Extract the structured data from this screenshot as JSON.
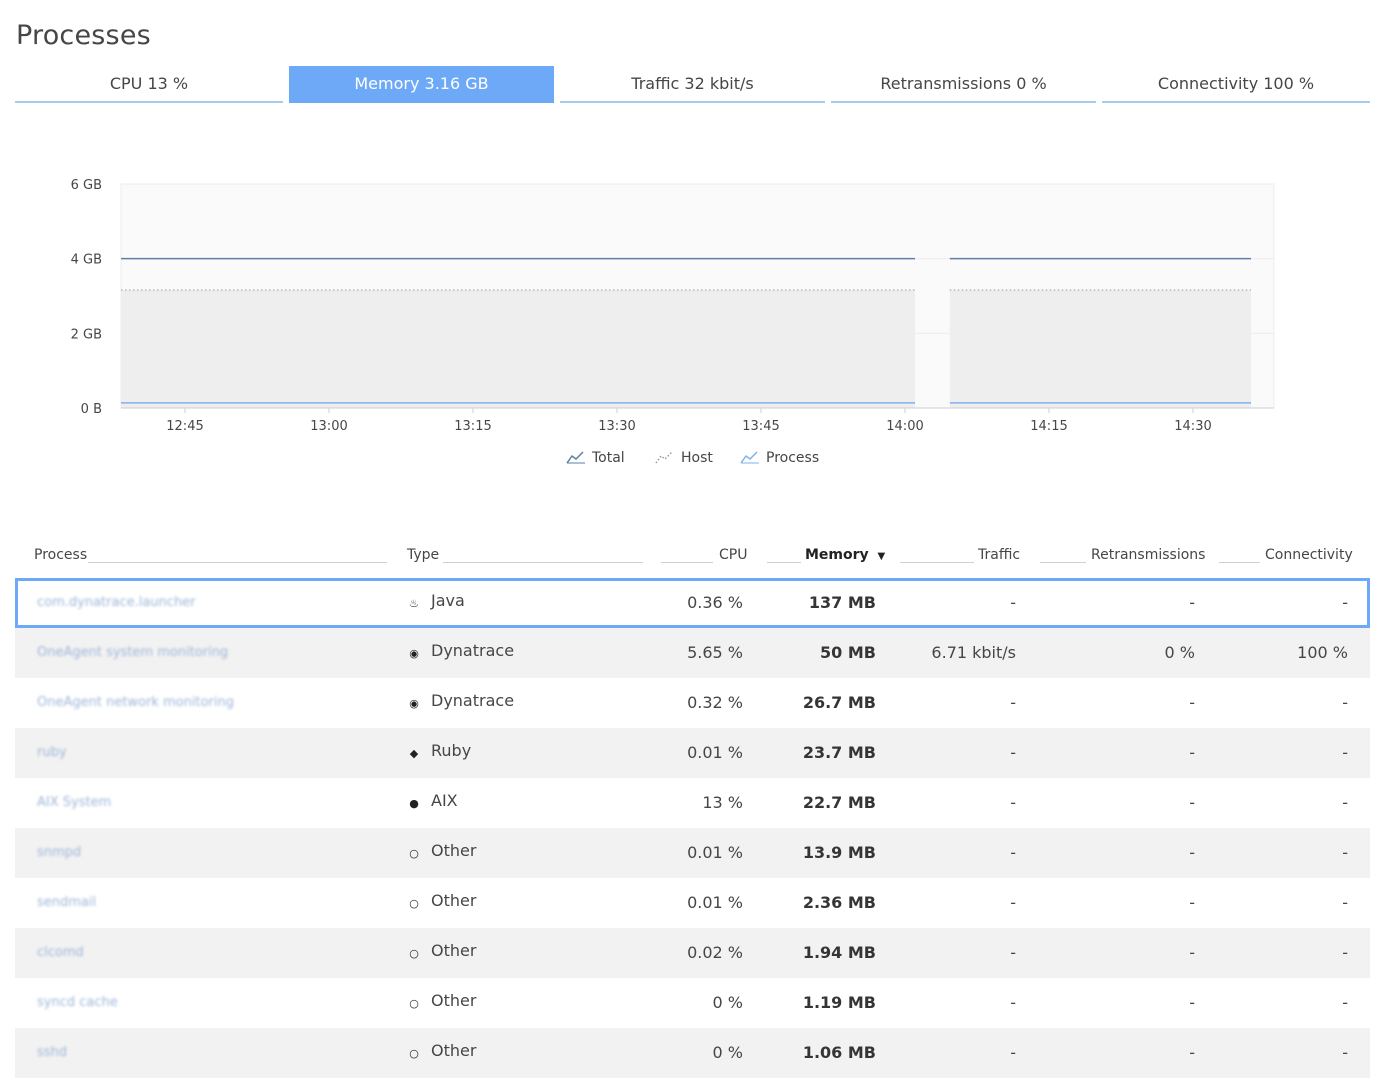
{
  "page": {
    "title": "Processes"
  },
  "tabs": [
    {
      "label": "CPU 13 %",
      "active": false
    },
    {
      "label": "Memory 3.16 GB",
      "active": true
    },
    {
      "label": "Traffic 32 kbit/s",
      "active": false
    },
    {
      "label": "Retransmissions 0 %",
      "active": false
    },
    {
      "label": "Connectivity 100 %",
      "active": false
    }
  ],
  "chart_data": {
    "type": "line",
    "y_ticks": [
      "6 GB",
      "4 GB",
      "2 GB",
      "0 B"
    ],
    "x_ticks": [
      "12:45",
      "13:00",
      "13:15",
      "13:30",
      "13:45",
      "14:00",
      "14:15",
      "14:30"
    ],
    "ylim": [
      0,
      6
    ],
    "series": [
      {
        "name": "Total",
        "value_gb": 4.0,
        "color": "#5b7fa6"
      },
      {
        "name": "Host",
        "value_gb": 3.16,
        "color": "#9a9a9a"
      },
      {
        "name": "Process",
        "value_gb": 0.137,
        "color": "#7fb2ee"
      }
    ],
    "gap": [
      "14:00",
      "14:03"
    ]
  },
  "legend": {
    "total": "Total",
    "host": "Host",
    "process": "Process"
  },
  "table": {
    "headers": {
      "process": "Process",
      "type": "Type",
      "cpu": "CPU",
      "memory": "Memory",
      "memory_sort": "▼",
      "traffic": "Traffic",
      "retransmissions": "Retransmissions",
      "connectivity": "Connectivity"
    },
    "rows": [
      {
        "name": "com.dynatrace.launcher",
        "type": "Java",
        "icon": "java-icon",
        "cpu": "0.36 %",
        "memory": "137 MB",
        "traffic": "-",
        "retransmissions": "-",
        "connectivity": "-"
      },
      {
        "name": "OneAgent system monitoring",
        "type": "Dynatrace",
        "icon": "dynatrace-icon",
        "cpu": "5.65 %",
        "memory": "50 MB",
        "traffic": "6.71 kbit/s",
        "retransmissions": "0 %",
        "connectivity": "100 %"
      },
      {
        "name": "OneAgent network monitoring",
        "type": "Dynatrace",
        "icon": "dynatrace-icon",
        "cpu": "0.32 %",
        "memory": "26.7 MB",
        "traffic": "-",
        "retransmissions": "-",
        "connectivity": "-"
      },
      {
        "name": "ruby",
        "type": "Ruby",
        "icon": "ruby-icon",
        "cpu": "0.01 %",
        "memory": "23.7 MB",
        "traffic": "-",
        "retransmissions": "-",
        "connectivity": "-"
      },
      {
        "name": "AIX System",
        "type": "AIX",
        "icon": "aix-icon",
        "cpu": "13 %",
        "memory": "22.7 MB",
        "traffic": "-",
        "retransmissions": "-",
        "connectivity": "-"
      },
      {
        "name": "snmpd",
        "type": "Other",
        "icon": "other-process-icon",
        "cpu": "0.01 %",
        "memory": "13.9 MB",
        "traffic": "-",
        "retransmissions": "-",
        "connectivity": "-"
      },
      {
        "name": "sendmail",
        "type": "Other",
        "icon": "other-process-icon",
        "cpu": "0.01 %",
        "memory": "2.36 MB",
        "traffic": "-",
        "retransmissions": "-",
        "connectivity": "-"
      },
      {
        "name": "clcomd",
        "type": "Other",
        "icon": "other-process-icon",
        "cpu": "0.02 %",
        "memory": "1.94 MB",
        "traffic": "-",
        "retransmissions": "-",
        "connectivity": "-"
      },
      {
        "name": "syncd cache",
        "type": "Other",
        "icon": "other-process-icon",
        "cpu": "0 %",
        "memory": "1.19 MB",
        "traffic": "-",
        "retransmissions": "-",
        "connectivity": "-"
      },
      {
        "name": "sshd",
        "type": "Other",
        "icon": "other-process-icon",
        "cpu": "0 %",
        "memory": "1.06 MB",
        "traffic": "-",
        "retransmissions": "-",
        "connectivity": "-"
      }
    ]
  }
}
